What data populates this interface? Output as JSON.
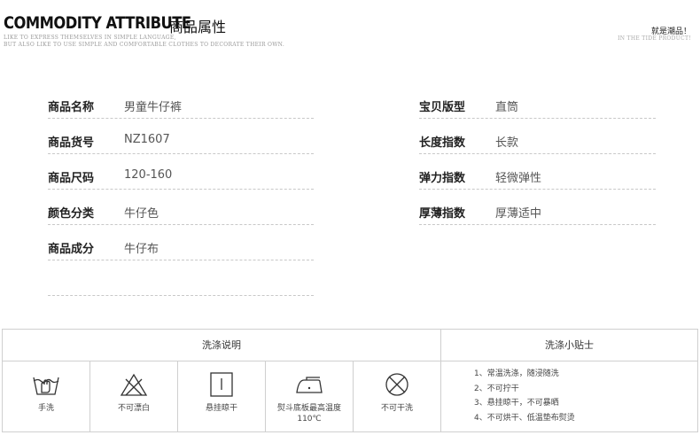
{
  "header": {
    "title_en": "COMMODITY ATTRIBUTE",
    "title_cn": "商品属性",
    "subtitle_line1": "LIKE TO EXPRESS THEMSELVES IN SIMPLE LANGUAGE,",
    "subtitle_line2": "BUT ALSO LIKE TO USE SIMPLE AND COMFORTABLE CLOTHES TO DECORATE THEIR OWN.",
    "tide_cn": "就是潮品！",
    "tide_en": "IN THE TIDE PRODUCT!"
  },
  "attributes_left": [
    {
      "label": "商品名称",
      "value": "男童牛仔裤"
    },
    {
      "label": "商品货号",
      "value": "NZ1607"
    },
    {
      "label": "商品尺码",
      "value": "120-160"
    },
    {
      "label": "颜色分类",
      "value": "牛仔色"
    },
    {
      "label": "商品成分",
      "value": "牛仔布"
    },
    {
      "label": "",
      "value": ""
    }
  ],
  "attributes_right": [
    {
      "label": "宝贝版型",
      "value": "直筒"
    },
    {
      "label": "长度指数",
      "value": "长款"
    },
    {
      "label": "弹力指数",
      "value": "轻微弹性"
    },
    {
      "label": "厚薄指数",
      "value": "厚薄适中"
    }
  ],
  "care": {
    "left_title": "洗涤说明",
    "right_title": "洗涤小贴士",
    "symbols": [
      {
        "icon": "hand-wash-icon",
        "caption": "手洗"
      },
      {
        "icon": "no-bleach-icon",
        "caption": "不可漂白"
      },
      {
        "icon": "hang-dry-icon",
        "caption": "悬挂晾干"
      },
      {
        "icon": "iron-110-icon",
        "caption": "熨斗底板最高温度110℃"
      },
      {
        "icon": "no-dry-clean-icon",
        "caption": "不可干洗"
      }
    ],
    "tips": [
      "1、常温洗涤，随浸随洗",
      "2、不可拧干",
      "3、悬挂晾干，不可暴晒",
      "4、不可烘干、低温垫布熨烫"
    ]
  }
}
